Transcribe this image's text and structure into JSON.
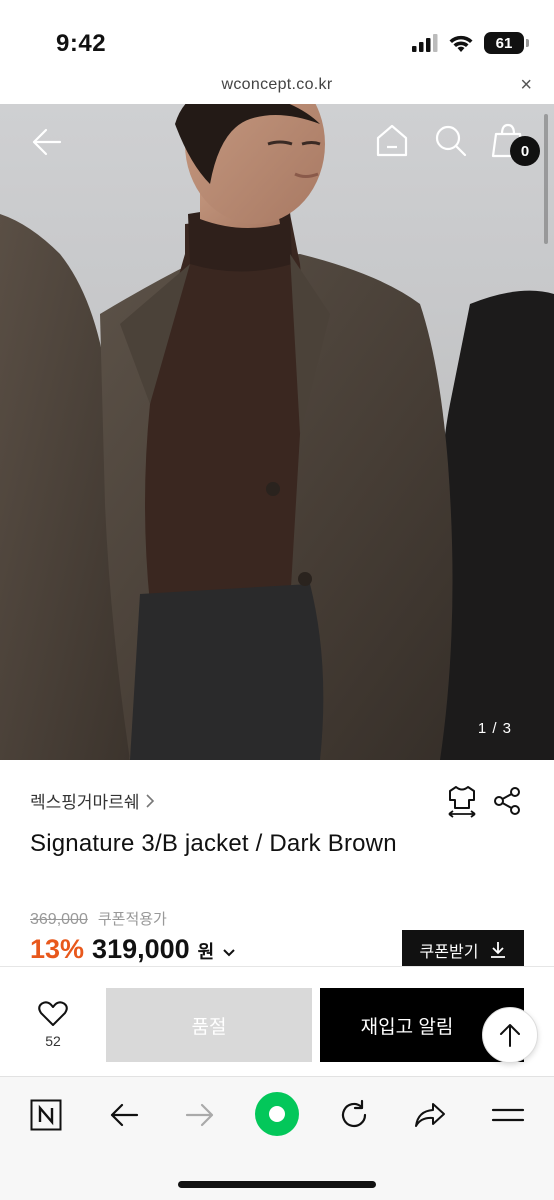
{
  "status_bar": {
    "time": "9:42",
    "battery": "61"
  },
  "browser": {
    "url": "wconcept.co.kr",
    "close_glyph": "×"
  },
  "gallery": {
    "counter": "1 / 3",
    "cart_count": "0"
  },
  "product": {
    "brand": "렉스핑거마르쉐",
    "name": "Signature 3/B jacket / Dark Brown",
    "original_price": "369,000",
    "coupon_note": "쿠폰적용가",
    "discount": "13%",
    "price": "319,000",
    "currency": "원",
    "coupon_button": "쿠폰받기"
  },
  "actions": {
    "like_count": "52",
    "soldout_label": "품절",
    "restock_label": "재입고 알림"
  },
  "colors": {
    "accent": "#e8581c",
    "primary": "#000000",
    "disabled": "#d9d9d9",
    "naver_green": "#03c75a"
  },
  "icons": [
    "back-arrow-icon",
    "home-icon",
    "search-icon",
    "shopping-bag-icon",
    "size-guide-icon",
    "share-icon",
    "heart-icon",
    "arrow-up-icon",
    "download-icon",
    "naver-n-icon",
    "forward-arrow-icon",
    "green-dot-icon",
    "reload-icon",
    "share-arrow-icon",
    "menu-icon"
  ]
}
